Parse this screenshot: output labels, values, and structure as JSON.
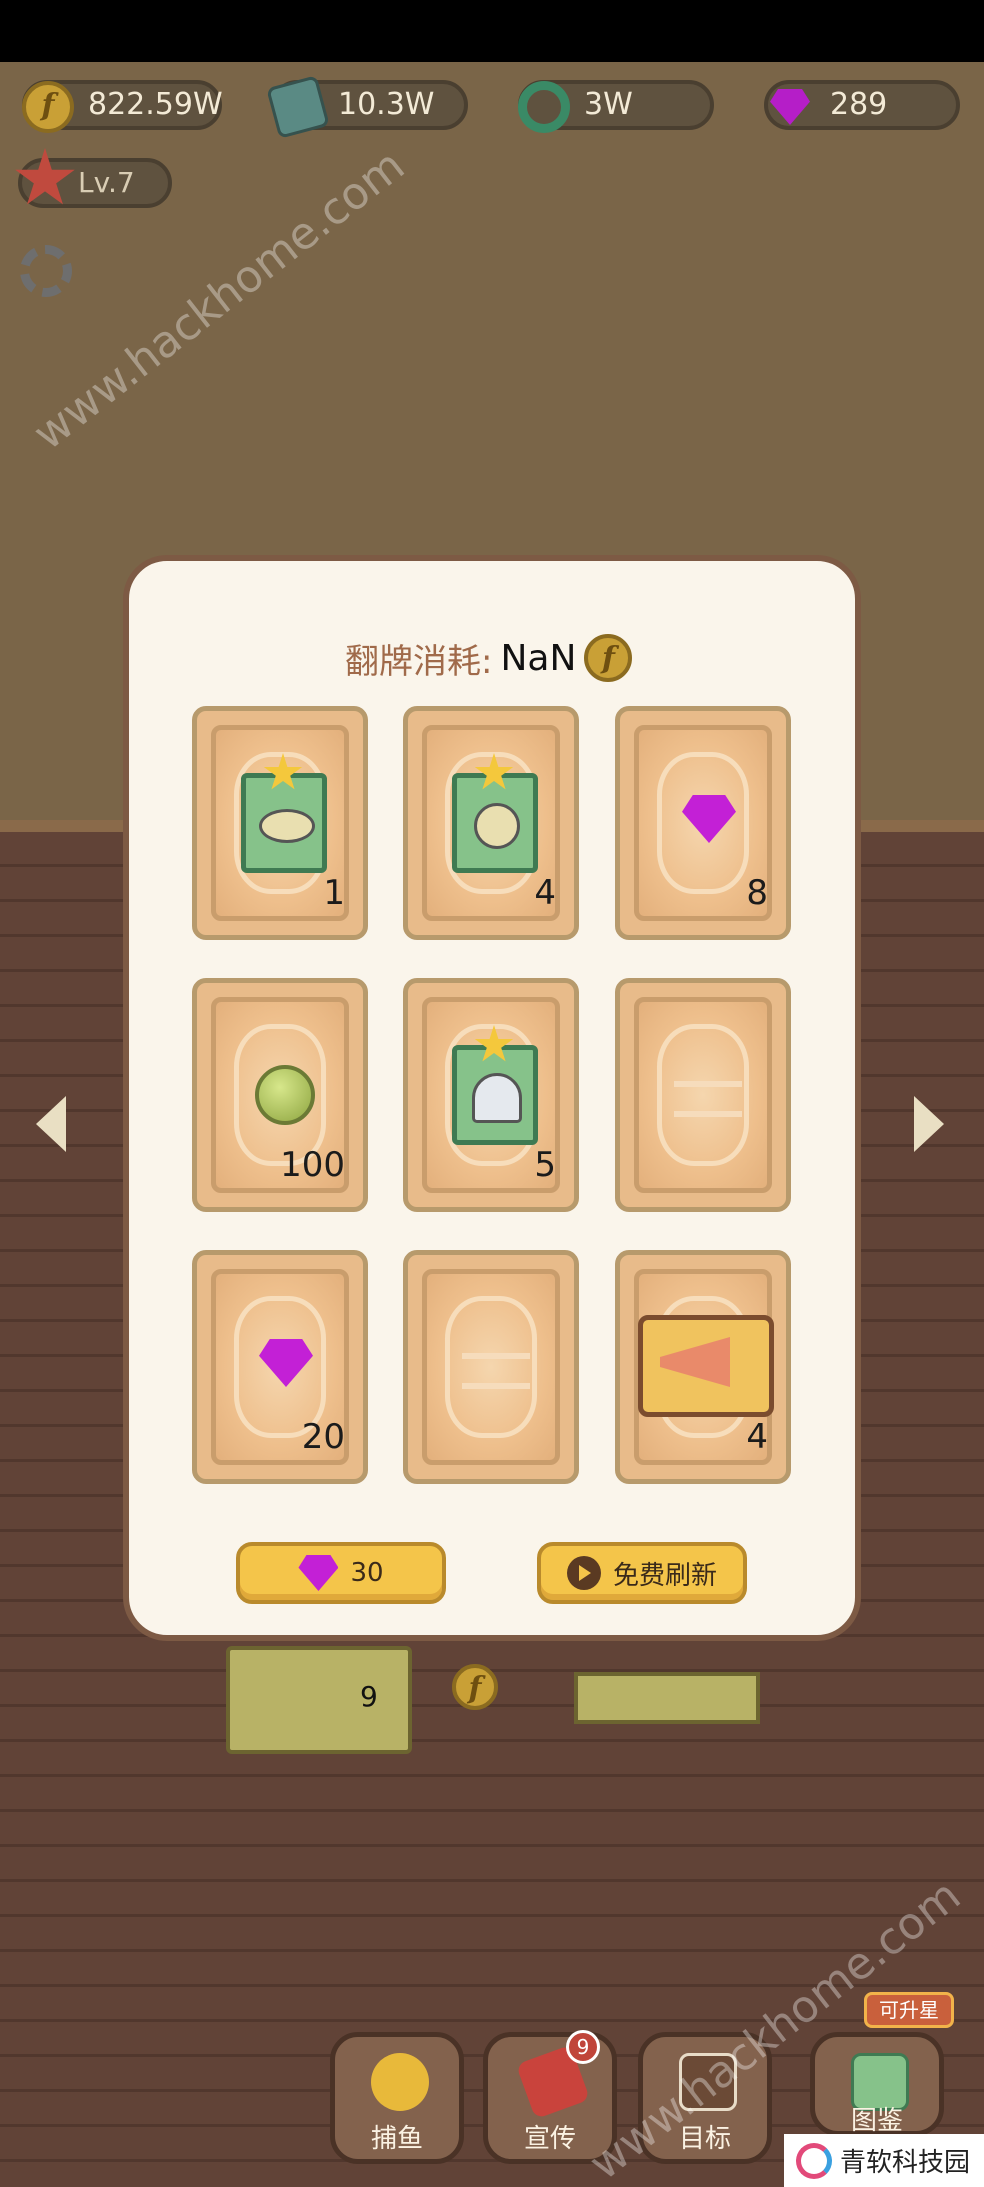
{
  "currencies": {
    "coins": "822.59W",
    "cash": "10.3W",
    "rings": "3W",
    "gems": "289"
  },
  "player": {
    "level": "Lv.7"
  },
  "modal": {
    "cost_label": "翻牌消耗:",
    "cost_value": "NaN",
    "cards": [
      {
        "reward": "fish-book",
        "count": "1"
      },
      {
        "reward": "pufferfish-book",
        "count": "4"
      },
      {
        "reward": "gem",
        "count": "8"
      },
      {
        "reward": "green-orb",
        "count": "100"
      },
      {
        "reward": "jellyfish-book",
        "count": "5"
      },
      {
        "reward": "face-down",
        "count": ""
      },
      {
        "reward": "gem",
        "count": "20"
      },
      {
        "reward": "face-down",
        "count": ""
      },
      {
        "reward": "megaphone",
        "count": "4"
      }
    ],
    "gem_button_value": "30",
    "refresh_button_label": "免费刷新"
  },
  "scene": {
    "rug_count": "9"
  },
  "nav": {
    "catch_label": "捕鱼",
    "promo_label": "宣传",
    "promo_badge": "9",
    "goal_label": "目标",
    "book_label": "图鉴",
    "upgrade_tag": "可升星"
  },
  "watermarks": {
    "top": "www.hackhome.com",
    "bottom": "www.hackhome.com",
    "logo_text": "青软科技园"
  },
  "colors": {
    "modal_bg": "#faf5eb",
    "card_bg": "#e8bb8a",
    "button_yellow": "#f4c54a",
    "gem_purple": "#c320d6"
  }
}
